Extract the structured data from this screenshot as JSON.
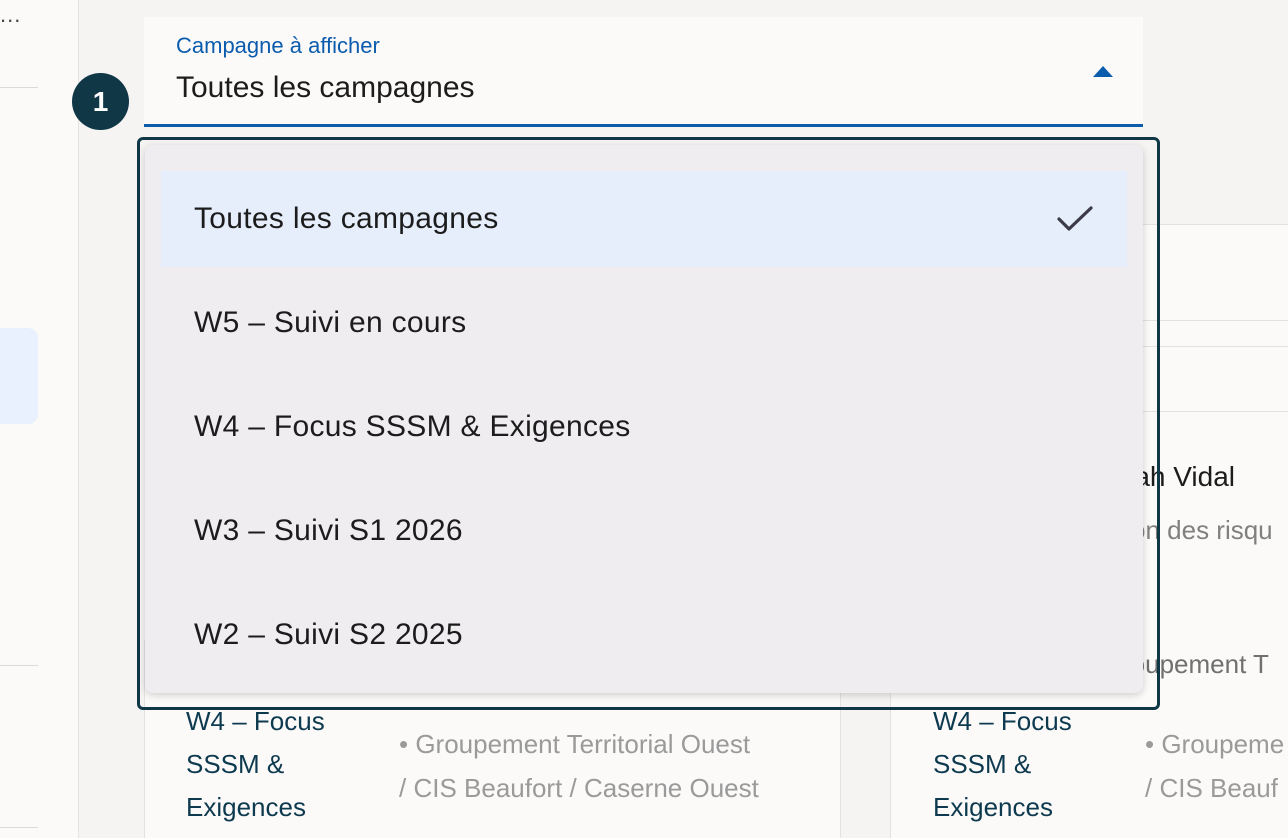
{
  "select": {
    "label": "Campagne à afficher",
    "value": "Toutes les campagnes"
  },
  "step_badge": "1",
  "dropdown": {
    "options": [
      {
        "label": "Toutes les campagnes",
        "selected": true
      },
      {
        "label": "W5 – Suivi en cours"
      },
      {
        "label": "W4 – Focus SSSM & Exigences"
      },
      {
        "label": "W3 – Suivi S1 2026"
      },
      {
        "label": "W2 – Suivi S2 2025"
      }
    ]
  },
  "background": {
    "sidebar_ellipsis": "...",
    "card_right": {
      "name_partial": "rah Vidal",
      "subtitle_partial": "on des risqu",
      "group_partial": "roupement T",
      "campaign_lines": [
        "W4 – Focus",
        "SSSM &",
        "Exigences"
      ],
      "path_lines": [
        "• Groupeme",
        "/ CIS Beauf"
      ]
    },
    "card_left": {
      "campaign_lines": [
        "W4 – Focus",
        "SSSM &",
        "Exigences"
      ],
      "path_lines": [
        "• Groupement Territorial Ouest",
        "/ CIS Beaufort / Caserne Ouest"
      ]
    }
  },
  "colors": {
    "accent": "#0b5cad",
    "badge": "#0f3746",
    "selected_option": "#e6eefb",
    "dropdown_bg": "#efedef"
  }
}
